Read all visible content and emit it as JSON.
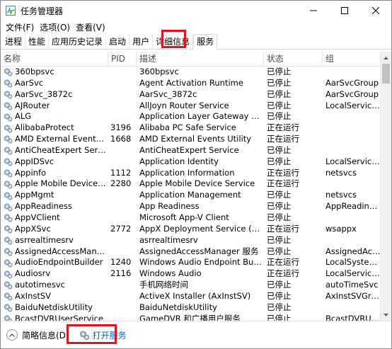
{
  "window": {
    "title": "任务管理器"
  },
  "menu": [
    "文件(F)",
    "选项(O)",
    "查看(V)"
  ],
  "tabs": [
    {
      "label": "进程",
      "active": false
    },
    {
      "label": "性能",
      "active": false
    },
    {
      "label": "应用历史记录",
      "active": false
    },
    {
      "label": "启动",
      "active": false
    },
    {
      "label": "用户",
      "active": false
    },
    {
      "label": "详细信息",
      "active": false
    },
    {
      "label": "服务",
      "active": true
    }
  ],
  "columns": [
    "名称",
    "PID",
    "描述",
    "状态",
    "组"
  ],
  "rows": [
    {
      "name": "360bpsvc",
      "pid": "",
      "desc": "360bpsvc",
      "status": "已停止",
      "group": ""
    },
    {
      "name": "AarSvc",
      "pid": "",
      "desc": "Agent Activation Runtime",
      "status": "已停止",
      "group": "AarSvcGroup"
    },
    {
      "name": "AarSvc_3872c",
      "pid": "",
      "desc": "AarSvc_3872c",
      "status": "已停止",
      "group": "AarSvcGroup"
    },
    {
      "name": "AJRouter",
      "pid": "",
      "desc": "AllJoyn Router Service",
      "status": "已停止",
      "group": "LocalService..."
    },
    {
      "name": "ALG",
      "pid": "",
      "desc": "Application Layer Gateway Service",
      "status": "已停止",
      "group": ""
    },
    {
      "name": "AlibabaProtect",
      "pid": "3196",
      "desc": "Alibaba PC Safe Service",
      "status": "正在运行",
      "group": ""
    },
    {
      "name": "AMD External Events Utili...",
      "pid": "1668",
      "desc": "AMD External Events Utility",
      "status": "正在运行",
      "group": ""
    },
    {
      "name": "AntiCheatExpert Service",
      "pid": "",
      "desc": "AntiCheatExpert Service",
      "status": "已停止",
      "group": ""
    },
    {
      "name": "AppIDSvc",
      "pid": "",
      "desc": "Application Identity",
      "status": "已停止",
      "group": "LocalService..."
    },
    {
      "name": "Appinfo",
      "pid": "1112",
      "desc": "Application Information",
      "status": "正在运行",
      "group": "netsvcs"
    },
    {
      "name": "Apple Mobile Device Ser...",
      "pid": "2280",
      "desc": "Apple Mobile Device Service",
      "status": "正在运行",
      "group": ""
    },
    {
      "name": "AppMgmt",
      "pid": "",
      "desc": "Application Management",
      "status": "已停止",
      "group": "netsvcs"
    },
    {
      "name": "AppReadiness",
      "pid": "",
      "desc": "App Readiness",
      "status": "已停止",
      "group": "AppReadiness"
    },
    {
      "name": "AppVClient",
      "pid": "",
      "desc": "Microsoft App-V Client",
      "status": "已停止",
      "group": ""
    },
    {
      "name": "AppXSvc",
      "pid": "2772",
      "desc": "AppX Deployment Service (AppX...",
      "status": "正在运行",
      "group": "wsappx"
    },
    {
      "name": "asrrealtimesrv",
      "pid": "",
      "desc": "asrrealtimesrv",
      "status": "已停止",
      "group": ""
    },
    {
      "name": "AssignedAccessManager...",
      "pid": "",
      "desc": "AssignedAccessManager 服务",
      "status": "已停止",
      "group": "AssignedAcc..."
    },
    {
      "name": "AudioEndpointBuilder",
      "pid": "1240",
      "desc": "Windows Audio Endpoint Builder",
      "status": "正在运行",
      "group": "LocalSystem..."
    },
    {
      "name": "Audiosrv",
      "pid": "2116",
      "desc": "Windows Audio",
      "status": "正在运行",
      "group": "LocalService..."
    },
    {
      "name": "autotimesvc",
      "pid": "",
      "desc": "手机网络时间",
      "status": "已停止",
      "group": "autoTimeSvc"
    },
    {
      "name": "AxInstSV",
      "pid": "",
      "desc": "ActiveX Installer (AxInstSV)",
      "status": "已停止",
      "group": "AxInstSVGroup"
    },
    {
      "name": "BaiduNetdiskUtility",
      "pid": "",
      "desc": "BaiduNetdiskUtility",
      "status": "已停止",
      "group": ""
    },
    {
      "name": "BcastDVRUserService",
      "pid": "",
      "desc": "GameDVR 和广播用户服务",
      "status": "已停止",
      "group": "BcastDVRUse..."
    }
  ],
  "footer": {
    "fewer_details": "简略信息(D)",
    "open_services": "打开服务"
  },
  "colors": {
    "highlight": "#e0151c",
    "link": "#0066cc"
  }
}
